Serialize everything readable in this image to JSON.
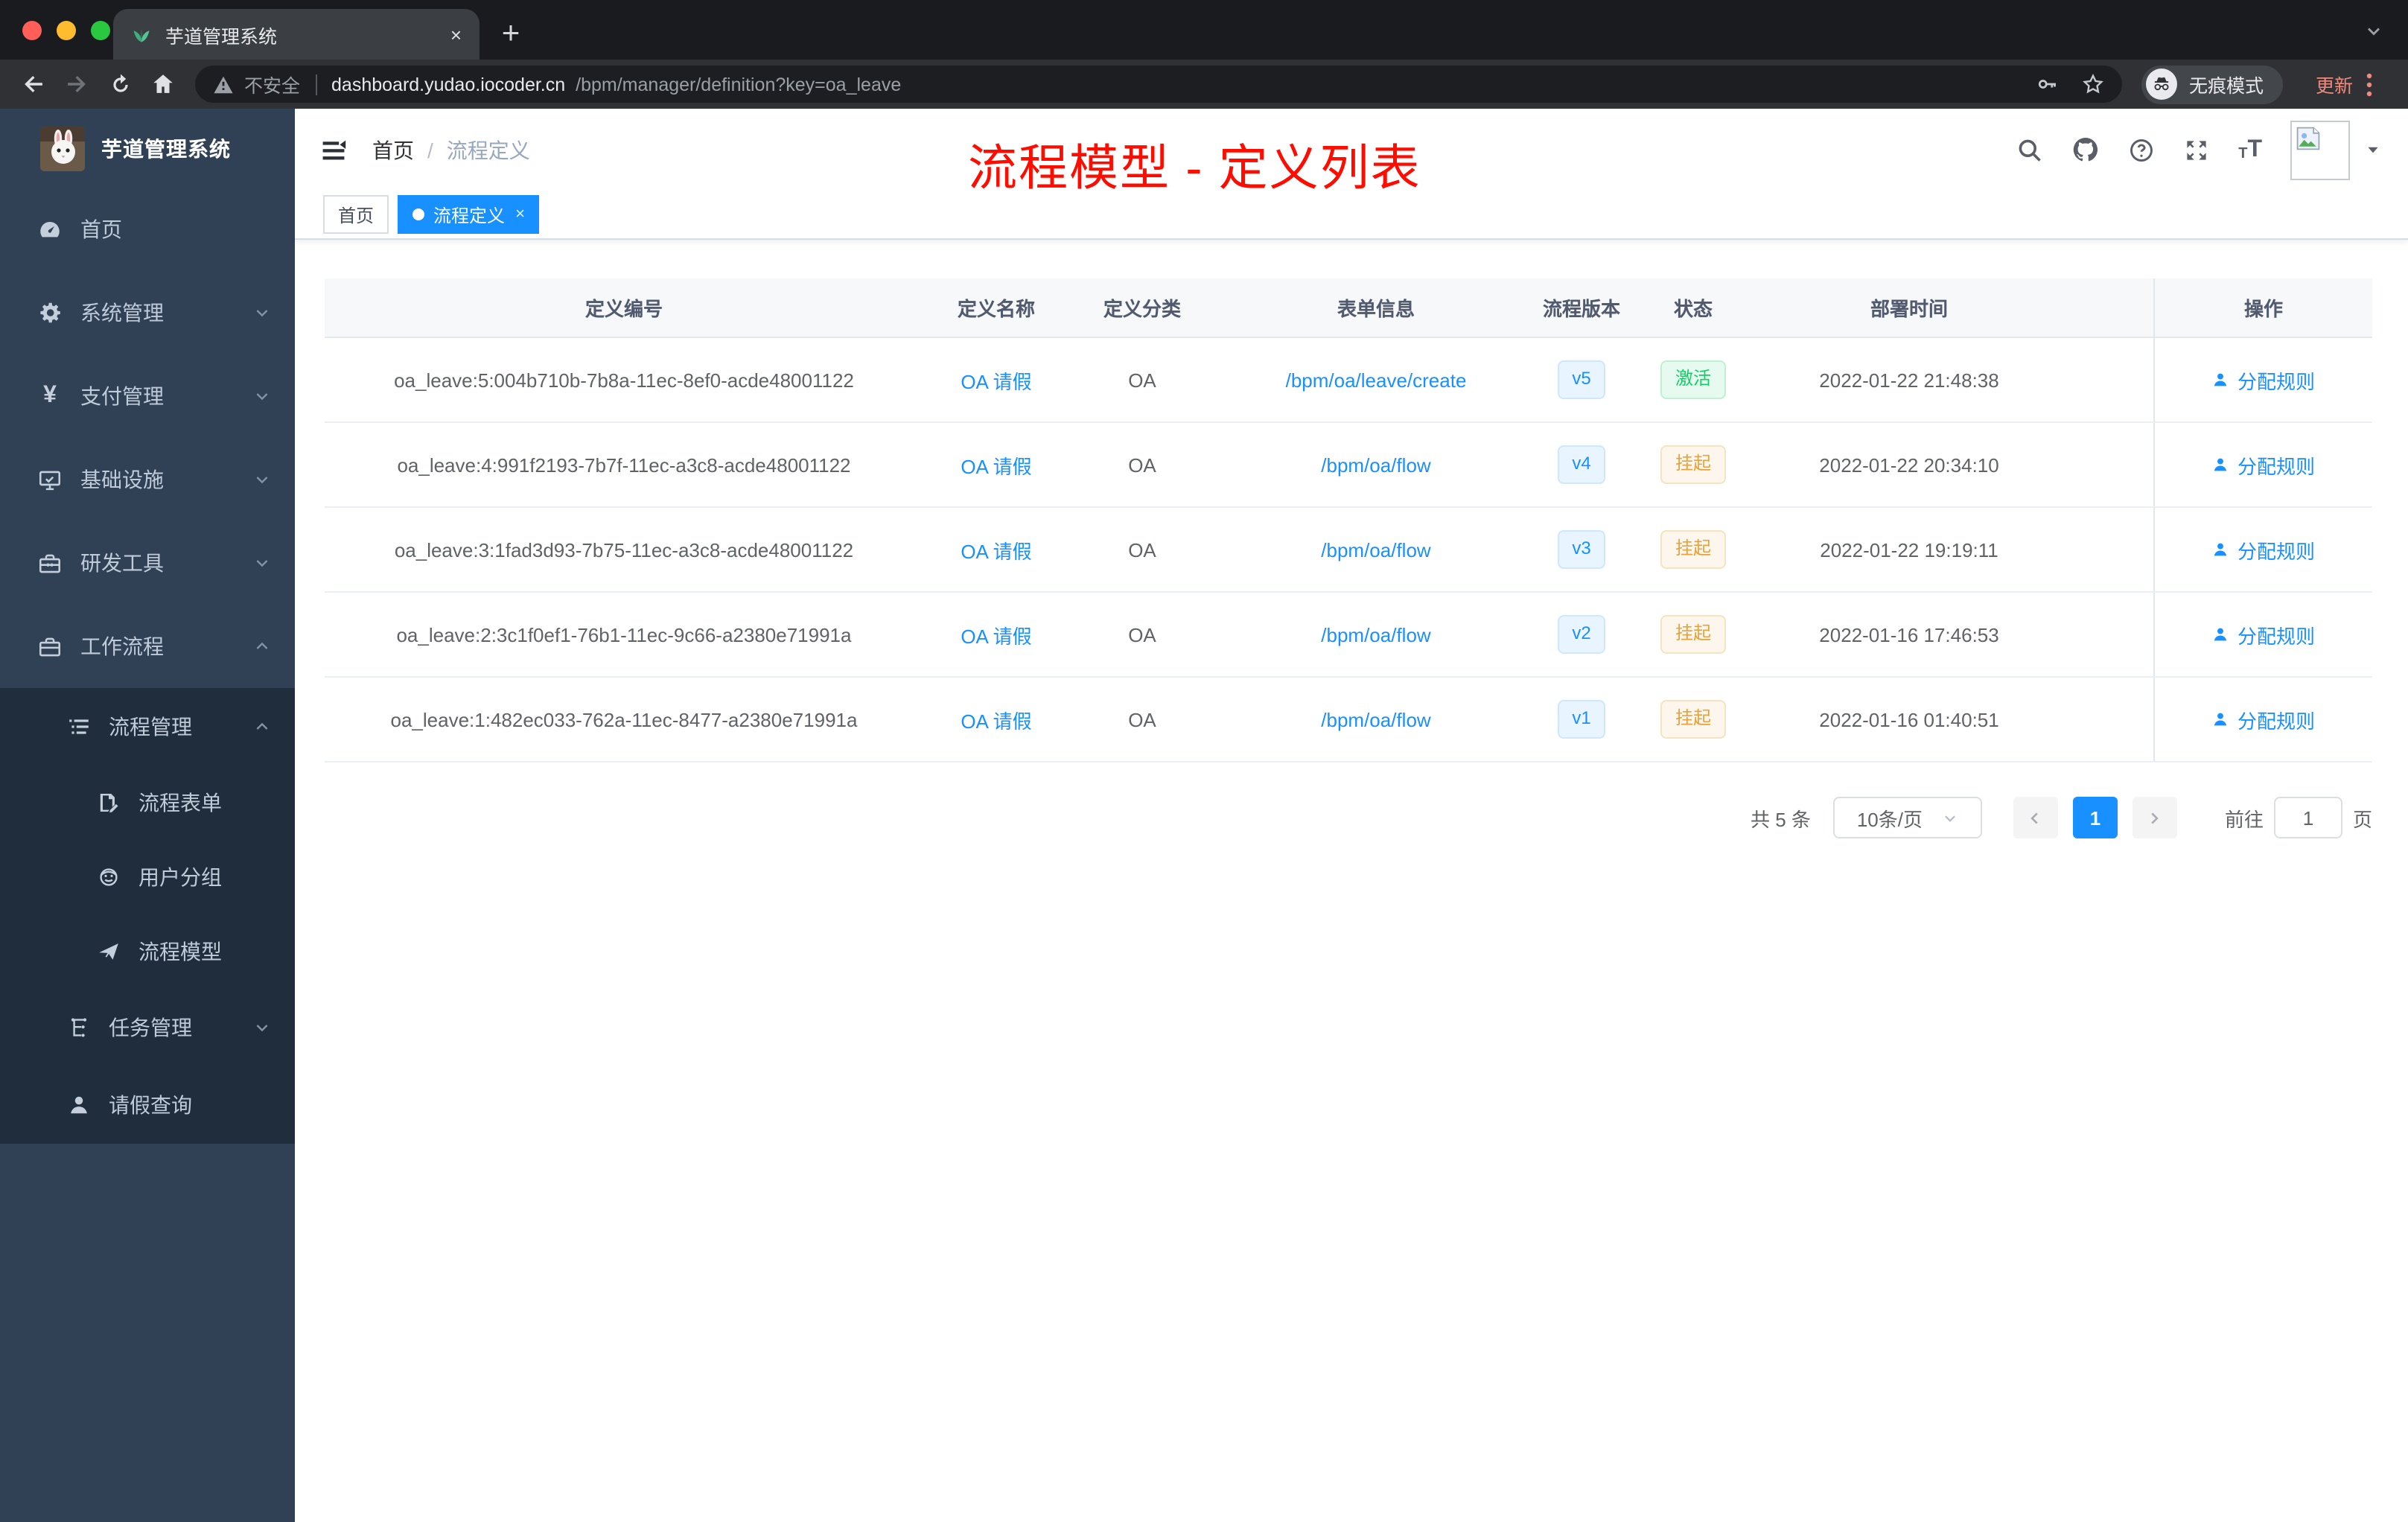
{
  "browser": {
    "tab": {
      "title": "芋道管理系统",
      "favicon": "plant-icon",
      "close_label": "×"
    },
    "new_tab_label": "+",
    "address": {
      "security_label": "不安全",
      "host": "dashboard.yudao.iocoder.cn",
      "path": "/bpm/manager/definition?key=oa_leave"
    },
    "incognito_label": "无痕模式",
    "update_label": "更新"
  },
  "sidebar": {
    "logo_title": "芋道管理系统",
    "items": [
      {
        "label": "首页",
        "icon": "dashboard-icon"
      },
      {
        "label": "系统管理",
        "icon": "gear-icon",
        "chevron": "down"
      },
      {
        "label": "支付管理",
        "icon": "yen-icon",
        "chevron": "down"
      },
      {
        "label": "基础设施",
        "icon": "monitor-icon",
        "chevron": "down"
      },
      {
        "label": "研发工具",
        "icon": "toolbox-icon",
        "chevron": "down"
      },
      {
        "label": "工作流程",
        "icon": "briefcase-icon",
        "chevron": "up",
        "children": [
          {
            "label": "流程管理",
            "icon": "tree-list-icon",
            "chevron": "up",
            "children": [
              {
                "label": "流程表单",
                "icon": "form-icon"
              },
              {
                "label": "用户分组",
                "icon": "user-group-icon"
              },
              {
                "label": "流程模型",
                "icon": "paper-plane-icon"
              }
            ]
          },
          {
            "label": "任务管理",
            "icon": "org-icon",
            "chevron": "down"
          },
          {
            "label": "请假查询",
            "icon": "person-icon"
          }
        ]
      }
    ]
  },
  "navbar": {
    "breadcrumb": {
      "home": "首页",
      "separator": "/",
      "current": "流程定义"
    },
    "annotation": "流程模型 - 定义列表"
  },
  "tags": [
    {
      "label": "首页",
      "active": false
    },
    {
      "label": "流程定义",
      "active": true,
      "closable": true
    }
  ],
  "table": {
    "columns": [
      "定义编号",
      "定义名称",
      "定义分类",
      "表单信息",
      "流程版本",
      "状态",
      "部署时间",
      "操作"
    ],
    "action_label": "分配规则",
    "rows": [
      {
        "id": "oa_leave:5:004b710b-7b8a-11ec-8ef0-acde48001122",
        "name": "OA 请假",
        "category": "OA",
        "form": "/bpm/oa/leave/create",
        "version": "v5",
        "status": "激活",
        "status_type": "success",
        "deploy_time": "2022-01-22 21:48:38"
      },
      {
        "id": "oa_leave:4:991f2193-7b7f-11ec-a3c8-acde48001122",
        "name": "OA 请假",
        "category": "OA",
        "form": "/bpm/oa/flow",
        "version": "v4",
        "status": "挂起",
        "status_type": "warning",
        "deploy_time": "2022-01-22 20:34:10"
      },
      {
        "id": "oa_leave:3:1fad3d93-7b75-11ec-a3c8-acde48001122",
        "name": "OA 请假",
        "category": "OA",
        "form": "/bpm/oa/flow",
        "version": "v3",
        "status": "挂起",
        "status_type": "warning",
        "deploy_time": "2022-01-22 19:19:11"
      },
      {
        "id": "oa_leave:2:3c1f0ef1-76b1-11ec-9c66-a2380e71991a",
        "name": "OA 请假",
        "category": "OA",
        "form": "/bpm/oa/flow",
        "version": "v2",
        "status": "挂起",
        "status_type": "warning",
        "deploy_time": "2022-01-16 17:46:53"
      },
      {
        "id": "oa_leave:1:482ec033-762a-11ec-8477-a2380e71991a",
        "name": "OA 请假",
        "category": "OA",
        "form": "/bpm/oa/flow",
        "version": "v1",
        "status": "挂起",
        "status_type": "warning",
        "deploy_time": "2022-01-16 01:40:51"
      }
    ]
  },
  "pagination": {
    "total": "共 5 条",
    "page_size": "10条/页",
    "current_page": "1",
    "goto_label": "前往",
    "goto_value": "1",
    "goto_suffix": "页"
  },
  "colors": {
    "primary": "#1890ff",
    "success": "#13ce66",
    "warning": "#e6a23c",
    "sidebar_bg": "#304156",
    "submenu_bg": "#1f2d3d",
    "annotation": "#fd0d00"
  }
}
